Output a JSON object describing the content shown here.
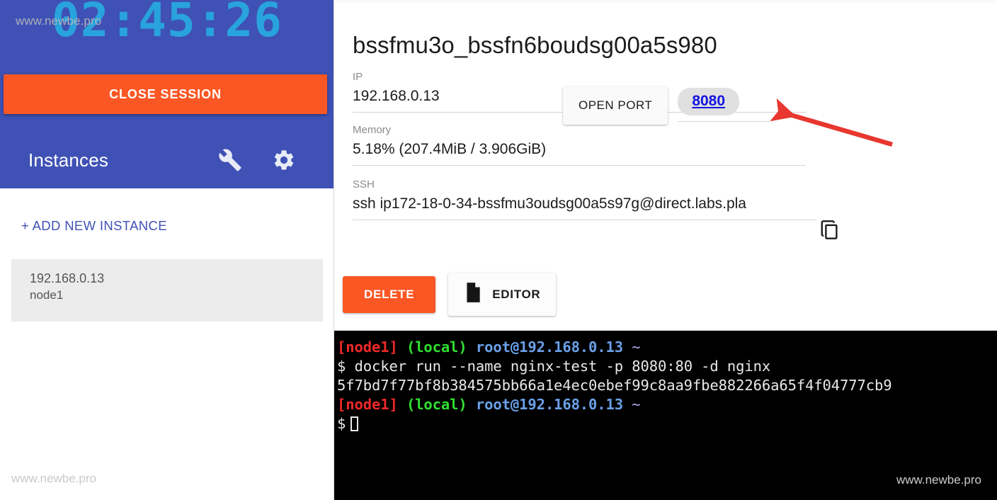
{
  "sidebar": {
    "timer": "02:45:26",
    "watermark_top": "www.newbe.pro",
    "watermark_bottom": "www.newbe.pro",
    "close_session_label": "CLOSE SESSION",
    "instances_title": "Instances",
    "wrench_icon": "wrench-icon",
    "gear_icon": "gear-icon",
    "add_instance_label": "+ ADD NEW INSTANCE",
    "instances": [
      {
        "ip": "192.168.0.13",
        "name": "node1"
      }
    ]
  },
  "detail": {
    "title": "bssfmu3o_bssfn6boudsg00a5s980",
    "ip_label": "IP",
    "ip_value": "192.168.0.13",
    "memory_label": "Memory",
    "memory_value": "5.18% (207.4MiB / 3.906GiB)",
    "ssh_label": "SSH",
    "ssh_value": "ssh ip172-18-0-34-bssfmu3oudsg00a5s97g@direct.labs.pla",
    "copy_icon": "copy-icon",
    "open_port_label": "OPEN PORT",
    "port_value": "8080",
    "delete_label": "DELETE",
    "editor_label": "EDITOR",
    "editor_icon": "document-icon"
  },
  "terminal": {
    "watermark": "www.newbe.pro",
    "lines": [
      {
        "type": "prompt",
        "host": "[node1]",
        "scope": "(local)",
        "user": "root@192.168.0.13",
        "path": "~"
      },
      {
        "type": "command",
        "sigil": "$",
        "text": "docker run --name nginx-test -p 8080:80 -d nginx"
      },
      {
        "type": "output",
        "text": "5f7bd7f77bf8b384575bb66a1e4ec0ebef99c8aa9fbe882266a65f4f04777cb9"
      },
      {
        "type": "prompt",
        "host": "[node1]",
        "scope": "(local)",
        "user": "root@192.168.0.13",
        "path": "~"
      },
      {
        "type": "input",
        "sigil": "$",
        "text": ""
      }
    ]
  },
  "annotation": {
    "arrow_color": "#e8372f",
    "arrow_target": "port-8080-link"
  },
  "colors": {
    "sidebar_blue": "#3f51b5",
    "accent_orange": "#fb5724",
    "timer_cyan": "#29a3dd",
    "link_blue": "#1414e0",
    "terminal_bg": "#000000"
  }
}
